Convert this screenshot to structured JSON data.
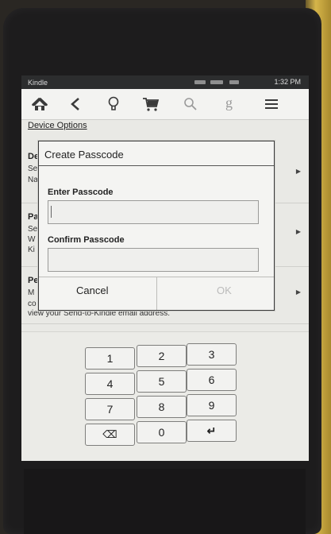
{
  "status_bar": {
    "carrier": "Kindle",
    "time": "1:32 PM"
  },
  "toolbar": {
    "icons": [
      "home-icon",
      "back-icon",
      "bulb-icon",
      "cart-icon",
      "search-icon",
      "goodreads-icon",
      "menu-icon"
    ]
  },
  "background": {
    "section_title": "Device Options",
    "row1_letter": "De",
    "row1_sub1": "Se",
    "row1_sub2": "Na",
    "row2_letter": "Pa",
    "row2_sub1": "Se",
    "row2_sub2": "W",
    "row2_sub3": "Ki",
    "row3_letter": "Pe",
    "row3_sub1": "M",
    "row3_sub2": "co",
    "row3_line": "view your Send-to-Kindle email address."
  },
  "dialog": {
    "title": "Create Passcode",
    "enter_label": "Enter Passcode",
    "enter_value": "",
    "confirm_label": "Confirm Passcode",
    "confirm_value": "",
    "cancel_label": "Cancel",
    "ok_label": "OK"
  },
  "keypad": {
    "keys": [
      "1",
      "2",
      "3",
      "4",
      "5",
      "6",
      "7",
      "8",
      "9",
      "⌫",
      "0",
      "↵"
    ]
  },
  "colors": {
    "accent": "#222222",
    "disabled": "#bbbbbb"
  }
}
